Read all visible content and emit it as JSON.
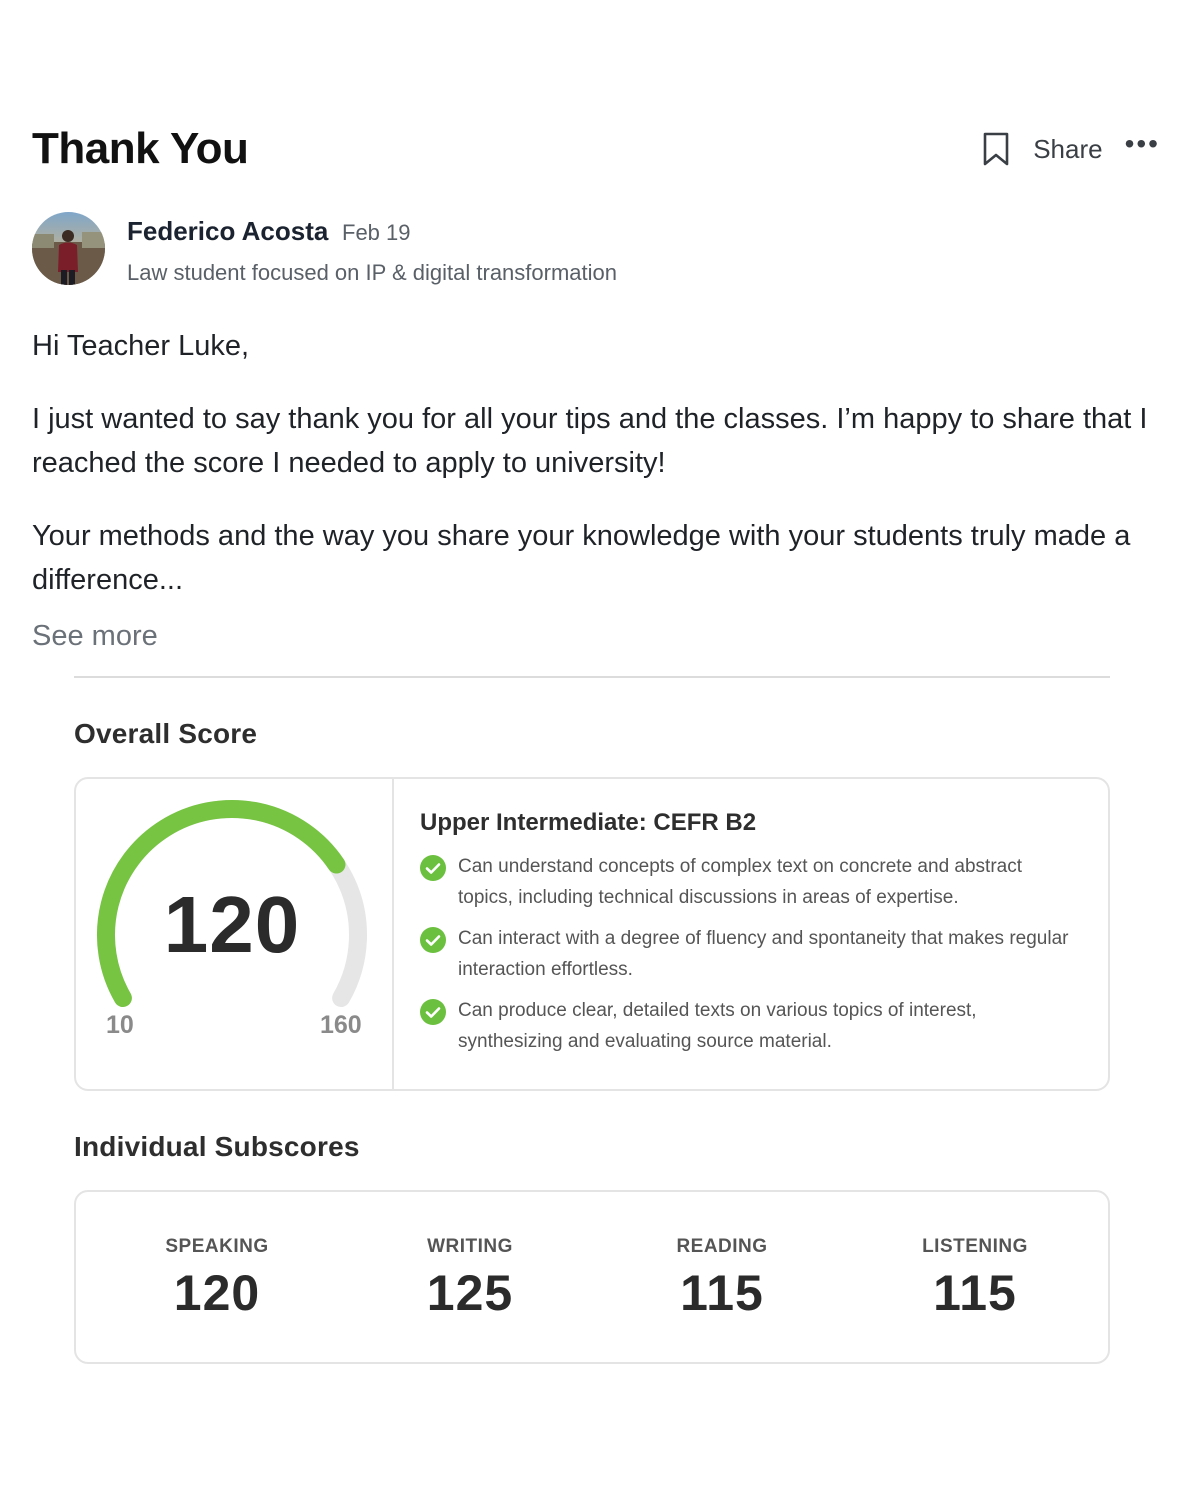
{
  "post": {
    "title": "Thank You",
    "actions": {
      "share_label": "Share",
      "more_label": "•••"
    }
  },
  "author": {
    "name": "Federico Acosta",
    "date": "Feb 19",
    "bio": "Law student focused on IP & digital transformation"
  },
  "body": {
    "greeting": "Hi Teacher Luke,",
    "paragraph1": "I just wanted to say thank you for all your tips and the classes. I’m happy to share that I reached the score I needed to apply to university!",
    "paragraph2": "Your methods and the way you share your knowledge with your students truly made a difference...",
    "see_more": "See more"
  },
  "overall": {
    "heading": "Overall Score",
    "score": "120",
    "min": "10",
    "max": "160",
    "score_value": 120,
    "min_value": 10,
    "max_value": 160,
    "gauge_fill_color": "#76c442",
    "gauge_track_color": "#e6e6e6",
    "level_title": "Upper Intermediate: CEFR B2",
    "criteria": [
      "Can understand concepts of complex text on concrete and abstract topics, including technical discussions in areas of expertise.",
      "Can interact with a degree of fluency and spontaneity that makes regular interaction effortless.",
      "Can produce clear, detailed texts on various topics of interest, synthesizing and evaluating source material."
    ],
    "check_icon": "check-circle-icon",
    "check_color": "#6cc03f"
  },
  "subscores": {
    "heading": "Individual Subscores",
    "items": [
      {
        "label": "SPEAKING",
        "value": "120"
      },
      {
        "label": "WRITING",
        "value": "125"
      },
      {
        "label": "READING",
        "value": "115"
      },
      {
        "label": "LISTENING",
        "value": "115"
      }
    ]
  }
}
